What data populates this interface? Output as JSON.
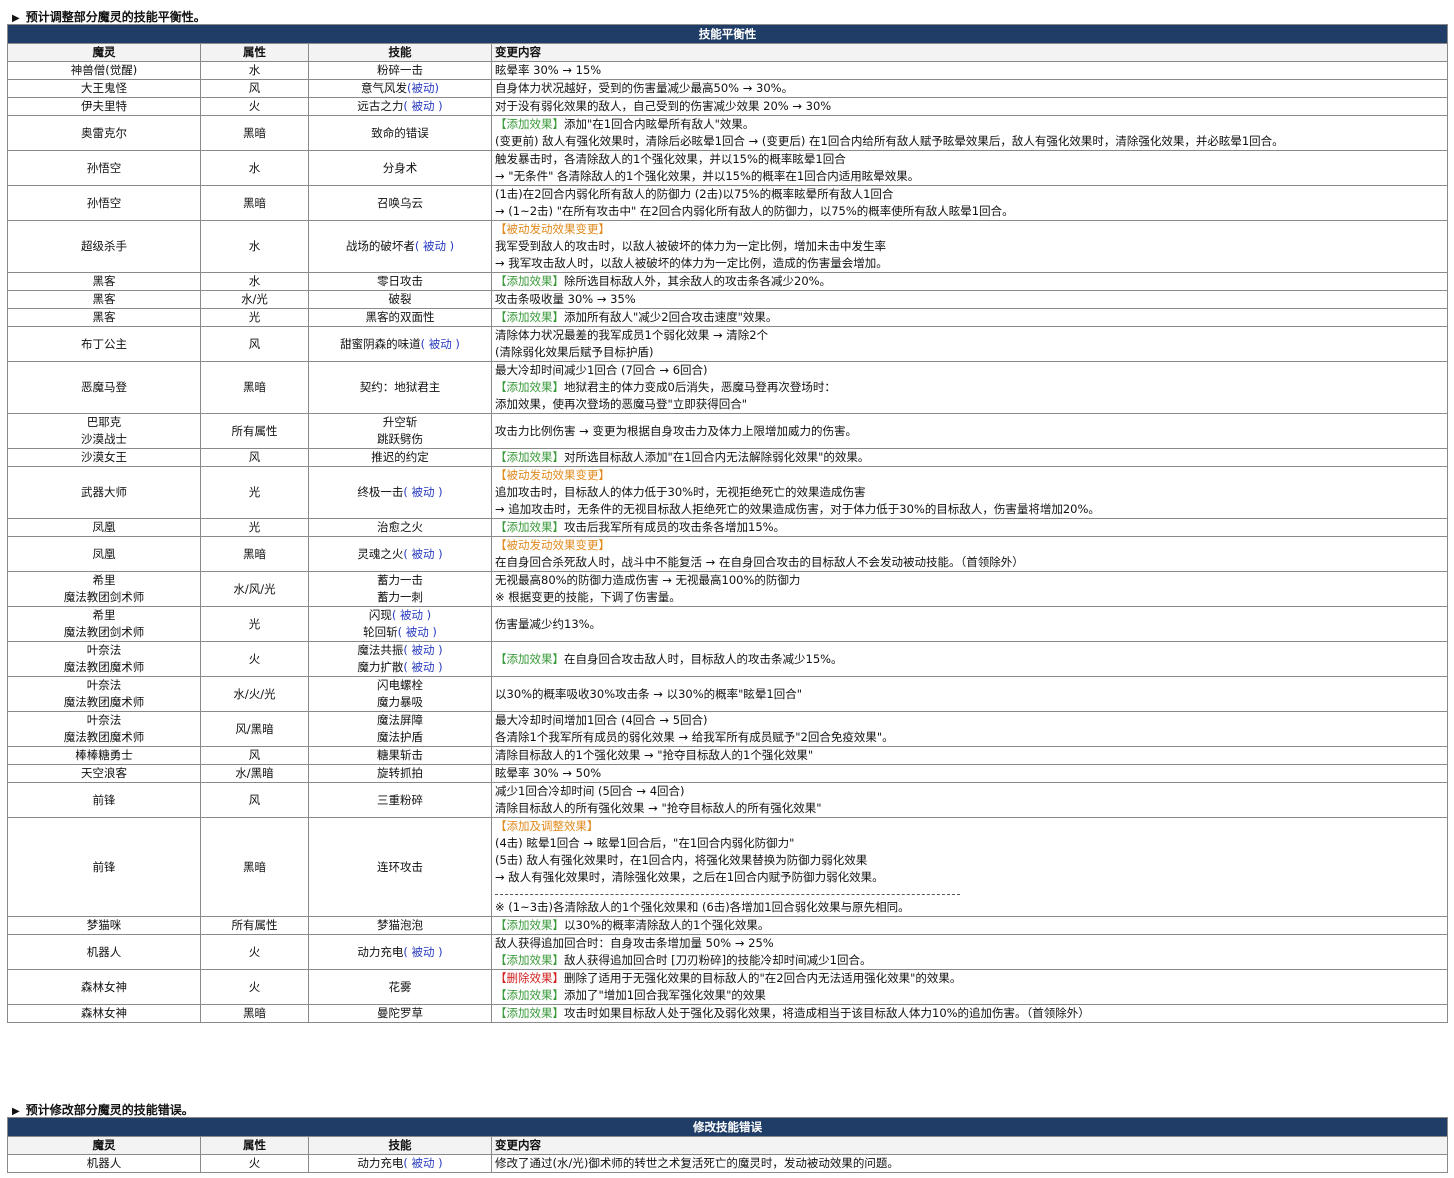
{
  "section1": {
    "title": "预计调整部分魔灵的技能平衡性。",
    "banner": "技能平衡性",
    "headers": [
      "魔灵",
      "属性",
      "技能",
      "变更内容"
    ]
  },
  "section2": {
    "title": "预计修改部分魔灵的技能错误。",
    "banner": "修改技能错误",
    "headers": [
      "魔灵",
      "属性",
      "技能",
      "变更内容"
    ]
  },
  "passive_label": "被动",
  "tags": {
    "add": "【添加效果】",
    "passive_change": "【被动发动效果变更】",
    "add_adjust": "【添加及调整效果】",
    "remove": "【删除效果】"
  },
  "rows": [
    {
      "name": [
        "神兽僧(觉醒)"
      ],
      "attr": "水",
      "skill": [
        {
          "t": "粉碎一击"
        }
      ],
      "content": [
        {
          "text": "眩晕率 30% → 15%"
        }
      ]
    },
    {
      "name": [
        "大王鬼怪"
      ],
      "attr": "风",
      "skill": [
        {
          "t": "意气风发",
          "p": "(被动)"
        }
      ],
      "content": [
        {
          "text": "自身体力状况越好，受到的伤害量减少最高50% → 30%。"
        }
      ]
    },
    {
      "name": [
        "伊夫里特"
      ],
      "attr": "火",
      "skill": [
        {
          "t": "远古之力",
          "p": "( 被动 )"
        }
      ],
      "content": [
        {
          "text": "对于没有弱化效果的敌人，自己受到的伤害减少效果 20% → 30%"
        }
      ]
    },
    {
      "name": [
        "奥雷克尔"
      ],
      "attr": "黑暗",
      "skill": [
        {
          "t": "致命的错误"
        }
      ],
      "content": [
        {
          "tag": "【添加效果】",
          "tc": "green",
          "text": "添加\"在1回合内眩晕所有敌人\"效果。"
        },
        {
          "text": "(变更前) 敌人有强化效果时，清除后必眩晕1回合 → (变更后) 在1回合内给所有敌人赋予眩晕效果后，敌人有强化效果时，清除强化效果，并必眩晕1回合。"
        }
      ]
    },
    {
      "name": [
        "孙悟空"
      ],
      "attr": "水",
      "skill": [
        {
          "t": "分身术"
        }
      ],
      "content": [
        {
          "text": "触发暴击时，各清除敌人的1个强化效果，并以15%的概率眩晕1回合"
        },
        {
          "text": "→ \"无条件\" 各清除敌人的1个强化效果，并以15%的概率在1回合内适用眩晕效果。"
        }
      ]
    },
    {
      "name": [
        "孙悟空"
      ],
      "attr": "黑暗",
      "skill": [
        {
          "t": "召唤乌云"
        }
      ],
      "content": [
        {
          "text": "(1击)在2回合内弱化所有敌人的防御力 (2击)以75%的概率眩晕所有敌人1回合"
        },
        {
          "text": "→ (1~2击) \"在所有攻击中\" 在2回合内弱化所有敌人的防御力，以75%的概率使所有敌人眩晕1回合。"
        }
      ]
    },
    {
      "name": [
        "超级杀手"
      ],
      "attr": "水",
      "skill": [
        {
          "t": "战场的破坏者",
          "p": "( 被动 )"
        }
      ],
      "content": [
        {
          "tag": "【被动发动效果变更】",
          "tc": "orange",
          "text": ""
        },
        {
          "text": "我军受到敌人的攻击时，以敌人被破坏的体力为一定比例，增加未击中发生率"
        },
        {
          "text": "→ 我军攻击敌人时，以敌人被破坏的体力为一定比例，造成的伤害量会增加。"
        }
      ]
    },
    {
      "name": [
        "黑客"
      ],
      "attr": "水",
      "skill": [
        {
          "t": "零日攻击"
        }
      ],
      "content": [
        {
          "tag": "【添加效果】",
          "tc": "green",
          "text": "除所选目标敌人外，其余敌人的攻击条各减少20%。"
        }
      ]
    },
    {
      "name": [
        "黑客"
      ],
      "attr": "水/光",
      "skill": [
        {
          "t": "破裂"
        }
      ],
      "content": [
        {
          "text": "攻击条吸收量 30% → 35%"
        }
      ]
    },
    {
      "name": [
        "黑客"
      ],
      "attr": "光",
      "skill": [
        {
          "t": "黑客的双面性"
        }
      ],
      "content": [
        {
          "tag": "【添加效果】",
          "tc": "green",
          "text": "添加所有敌人\"减少2回合攻击速度\"效果。"
        }
      ]
    },
    {
      "name": [
        "布丁公主"
      ],
      "attr": "风",
      "skill": [
        {
          "t": "甜蜜阴森的味道",
          "p": "( 被动 )"
        }
      ],
      "content": [
        {
          "text": "清除体力状况最差的我军成员1个弱化效果 → 清除2个"
        },
        {
          "text": "(清除弱化效果后赋予目标护盾)"
        }
      ]
    },
    {
      "name": [
        "恶魔马登"
      ],
      "attr": "黑暗",
      "skill": [
        {
          "t": "契约：地狱君主"
        }
      ],
      "content": [
        {
          "text": "最大冷却时间减少1回合 (7回合 → 6回合)"
        },
        {
          "tag": "【添加效果】",
          "tc": "green",
          "text": "地狱君主的体力变成0后消失，恶魔马登再次登场时："
        },
        {
          "text": "添加效果，使再次登场的恶魔马登\"立即获得回合\""
        }
      ]
    },
    {
      "name": [
        "巴耶克",
        "沙漠战士"
      ],
      "attr": "所有属性",
      "skill": [
        {
          "t": "升空斩"
        },
        {
          "t": "跳跃劈伤"
        }
      ],
      "content": [
        {
          "text": "攻击力比例伤害 → 变更为根据自身攻击力及体力上限增加威力的伤害。"
        }
      ]
    },
    {
      "name": [
        "沙漠女王"
      ],
      "attr": "风",
      "skill": [
        {
          "t": "推迟的约定"
        }
      ],
      "content": [
        {
          "tag": "【添加效果】",
          "tc": "green",
          "text": "对所选目标敌人添加\"在1回合内无法解除弱化效果\"的效果。"
        }
      ]
    },
    {
      "name": [
        "武器大师"
      ],
      "attr": "光",
      "skill": [
        {
          "t": "终极一击",
          "p": "( 被动 )"
        }
      ],
      "content": [
        {
          "tag": "【被动发动效果变更】",
          "tc": "orange",
          "text": ""
        },
        {
          "text": "追加攻击时，目标敌人的体力低于30%时，无视拒绝死亡的效果造成伤害"
        },
        {
          "text": "→ 追加攻击时，无条件的无视目标敌人拒绝死亡的效果造成伤害，对于体力低于30%的目标敌人，伤害量将增加20%。"
        }
      ]
    },
    {
      "name": [
        "凤凰"
      ],
      "attr": "光",
      "skill": [
        {
          "t": "治愈之火"
        }
      ],
      "content": [
        {
          "tag": "【添加效果】",
          "tc": "green",
          "text": "攻击后我军所有成员的攻击条各增加15%。"
        }
      ]
    },
    {
      "name": [
        "凤凰"
      ],
      "attr": "黑暗",
      "skill": [
        {
          "t": "灵魂之火",
          "p": "( 被动 )"
        }
      ],
      "content": [
        {
          "tag": "【被动发动效果变更】",
          "tc": "orange",
          "text": ""
        },
        {
          "text": "在自身回合杀死敌人时，战斗中不能复活 → 在自身回合攻击的目标敌人不会发动被动技能。（首领除外）"
        }
      ]
    },
    {
      "name": [
        "希里",
        "魔法教团剑术师"
      ],
      "attr": "水/风/光",
      "skill": [
        {
          "t": "蓄力一击"
        },
        {
          "t": "蓄力一刺"
        }
      ],
      "content": [
        {
          "text": "无视最高80%的防御力造成伤害 → 无视最高100%的防御力"
        },
        {
          "text": "※ 根据变更的技能，下调了伤害量。"
        }
      ]
    },
    {
      "name": [
        "希里",
        "魔法教团剑术师"
      ],
      "attr": "光",
      "skill": [
        {
          "t": "闪现",
          "p": "( 被动 )"
        },
        {
          "t": "轮回斩",
          "p": "( 被动 )"
        }
      ],
      "content": [
        {
          "text": "伤害量减少约13%。"
        }
      ]
    },
    {
      "name": [
        "叶奈法",
        "魔法教团魔术师"
      ],
      "attr": "火",
      "skill": [
        {
          "t": "魔法共振",
          "p": "( 被动 )"
        },
        {
          "t": "魔力扩散",
          "p": "( 被动 )"
        }
      ],
      "content": [
        {
          "tag": "【添加效果】",
          "tc": "green",
          "text": "在自身回合攻击敌人时，目标敌人的攻击条减少15%。"
        }
      ]
    },
    {
      "name": [
        "叶奈法",
        "魔法教团魔术师"
      ],
      "attr": "水/火/光",
      "skill": [
        {
          "t": "闪电螺栓"
        },
        {
          "t": "魔力暴吸"
        }
      ],
      "content": [
        {
          "text": "以30%的概率吸收30%攻击条 → 以30%的概率\"眩晕1回合\""
        }
      ]
    },
    {
      "name": [
        "叶奈法",
        "魔法教团魔术师"
      ],
      "attr": "风/黑暗",
      "skill": [
        {
          "t": "魔法屏障"
        },
        {
          "t": "魔法护盾"
        }
      ],
      "content": [
        {
          "text": "最大冷却时间增加1回合 (4回合 → 5回合)"
        },
        {
          "text": "各清除1个我军所有成员的弱化效果 → 给我军所有成员赋予\"2回合免疫效果\"。"
        }
      ]
    },
    {
      "name": [
        "棒棒糖勇士"
      ],
      "attr": "风",
      "skill": [
        {
          "t": "糖果斩击"
        }
      ],
      "content": [
        {
          "text": "清除目标敌人的1个强化效果 → \"抢夺目标敌人的1个强化效果\""
        }
      ]
    },
    {
      "name": [
        "天空浪客"
      ],
      "attr": "水/黑暗",
      "skill": [
        {
          "t": "旋转抓拍"
        }
      ],
      "content": [
        {
          "text": "眩晕率 30% → 50%"
        }
      ]
    },
    {
      "name": [
        "前锋"
      ],
      "attr": "风",
      "skill": [
        {
          "t": "三重粉碎"
        }
      ],
      "content": [
        {
          "text": "减少1回合冷却时间 (5回合 → 4回合)"
        },
        {
          "text": "清除目标敌人的所有强化效果 → \"抢夺目标敌人的所有强化效果\""
        }
      ]
    },
    {
      "name": [
        "前锋"
      ],
      "attr": "黑暗",
      "skill": [
        {
          "t": "连环攻击"
        }
      ],
      "content": [
        {
          "tag": "【添加及调整效果】",
          "tc": "orange",
          "text": ""
        },
        {
          "text": "(4击) 眩晕1回合 → 眩晕1回合后，\"在1回合内弱化防御力\""
        },
        {
          "text": "(5击) 敌人有强化效果时，在1回合内，将强化效果替换为防御力弱化效果"
        },
        {
          "text": "→ 敌人有强化效果时，清除强化效果，之后在1回合内赋予防御力弱化效果。"
        },
        {
          "dash": true
        },
        {
          "text": "※ (1~3击)各清除敌人的1个强化效果和 (6击)各增加1回合弱化效果与原先相同。"
        }
      ]
    },
    {
      "name": [
        "梦猫咪"
      ],
      "attr": "所有属性",
      "skill": [
        {
          "t": "梦猫泡泡"
        }
      ],
      "content": [
        {
          "tag": "【添加效果】",
          "tc": "green",
          "text": "以30%的概率清除敌人的1个强化效果。"
        }
      ]
    },
    {
      "name": [
        "机器人"
      ],
      "attr": "火",
      "skill": [
        {
          "t": "动力充电",
          "p": "( 被动 )"
        }
      ],
      "content": [
        {
          "text": "敌人获得追加回合时：自身攻击条增加量 50% → 25%"
        },
        {
          "tag": "【添加效果】",
          "tc": "green",
          "text": "敌人获得追加回合时 [刀刃粉碎]的技能冷却时间减少1回合。"
        }
      ]
    },
    {
      "name": [
        "森林女神"
      ],
      "attr": "火",
      "skill": [
        {
          "t": "花雾"
        }
      ],
      "content": [
        {
          "tag": "【删除效果】",
          "tc": "red",
          "text": "删除了适用于无强化效果的目标敌人的\"在2回合内无法适用强化效果\"的效果。"
        },
        {
          "tag": "【添加效果】",
          "tc": "green",
          "text": "添加了\"增加1回合我军强化效果\"的效果"
        }
      ]
    },
    {
      "name": [
        "森林女神"
      ],
      "attr": "黑暗",
      "skill": [
        {
          "t": "曼陀罗草"
        }
      ],
      "content": [
        {
          "tag": "【添加效果】",
          "tc": "green",
          "text": "攻击时如果目标敌人处于强化及弱化效果，将造成相当于该目标敌人体力10%的追加伤害。（首领除外）"
        }
      ]
    }
  ],
  "rows2": [
    {
      "name": [
        "机器人"
      ],
      "attr": "火",
      "skill": [
        {
          "t": "动力充电",
          "p": "( 被动 )"
        }
      ],
      "content": [
        {
          "text": "修改了通过(水/光)御术师的转世之术复活死亡的魔灵时，发动被动效果的问题。"
        }
      ]
    }
  ]
}
